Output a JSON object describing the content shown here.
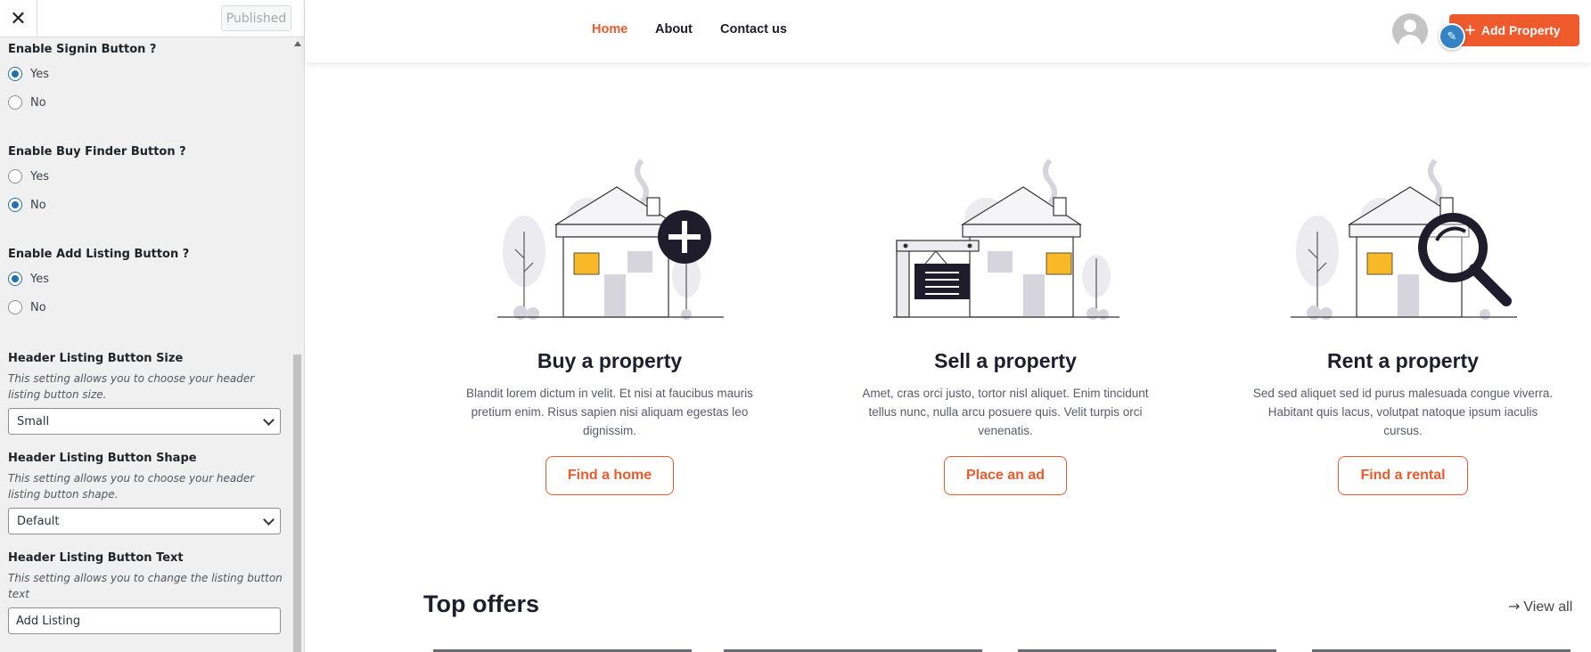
{
  "customizer": {
    "close_icon": "✕",
    "publish_label": "Published",
    "groups": {
      "signin": {
        "title": "Enable Signin Button ?",
        "options": [
          "Yes",
          "No"
        ],
        "selected": "Yes"
      },
      "buy_finder": {
        "title": "Enable Buy Finder Button ?",
        "options": [
          "Yes",
          "No"
        ],
        "selected": "No"
      },
      "add_listing": {
        "title": "Enable Add Listing Button ?",
        "options": [
          "Yes",
          "No"
        ],
        "selected": "Yes"
      }
    },
    "size": {
      "title": "Header Listing Button Size",
      "desc": "This setting allows you to choose your header listing button size.",
      "value": "Small"
    },
    "shape": {
      "title": "Header Listing Button Shape",
      "desc": "This setting allows you to choose your header listing button shape.",
      "value": "Default"
    },
    "text": {
      "title": "Header Listing Button Text",
      "desc": "This setting allows you to change the listing button text",
      "value": "Add Listing"
    }
  },
  "site": {
    "nav": [
      "Home",
      "About",
      "Contact us"
    ],
    "active_nav": "Home",
    "add_property_label": "Add Property",
    "accent_color": "#ee5a2c",
    "cards": [
      {
        "title": "Buy a property",
        "text": "Blandit lorem dictum in velit. Et nisi at faucibus mauris pretium enim. Risus sapien nisi aliquam egestas leo dignissim.",
        "button": "Find a home",
        "icon": "house-plus-icon"
      },
      {
        "title": "Sell a property",
        "text": "Amet, cras orci justo, tortor nisl aliquet. Enim tincidunt tellus nunc, nulla arcu posuere quis. Velit turpis orci venenatis.",
        "button": "Place an ad",
        "icon": "house-sign-icon"
      },
      {
        "title": "Rent a property",
        "text": "Sed sed aliquet sed id purus malesuada congue viverra. Habitant quis lacus, volutpat natoque ipsum iaculis cursus.",
        "button": "Find a rental",
        "icon": "house-search-icon"
      }
    ],
    "top_offers_title": "Top offers",
    "view_all_label": "View all"
  }
}
